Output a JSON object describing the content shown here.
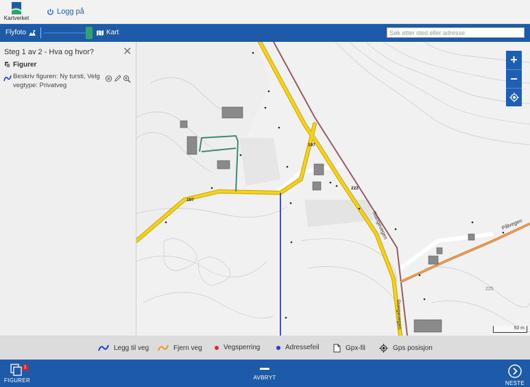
{
  "header": {
    "logo_text": "Kartverket",
    "login_label": "Logg på"
  },
  "toolbar": {
    "aerial_label": "Flyfoto",
    "map_label": "Kart",
    "search_placeholder": "Søk etter sted eller adresse"
  },
  "panel": {
    "title": "Steg 1 av 2 - Hva og hvor?",
    "section": "Figurer",
    "figure_text": "Beskriv figuren: Ny tursti, Velg vegtype: Privatveg"
  },
  "map": {
    "labels": {
      "road_197_a": "197",
      "road_197_b": "197",
      "road_222": "222",
      "stangevegen_1": "Stangevegen",
      "stangevegen_2": "Stangevegen",
      "palvegen": "Pålvegen",
      "contour_225": "225"
    },
    "scale_label": "50 m",
    "zoom_in": "+",
    "zoom_out": "−"
  },
  "legend": [
    {
      "label": "Legg til veg",
      "icon": "road-curve-blue"
    },
    {
      "label": "Fjern veg",
      "icon": "road-curve-orange"
    },
    {
      "label": "Vegsperring",
      "icon": "red-dot"
    },
    {
      "label": "Adressefeil",
      "icon": "blue-dot"
    },
    {
      "label": "Gpx-fil",
      "icon": "file-icon"
    },
    {
      "label": "Gps posisjon",
      "icon": "gps-icon"
    }
  ],
  "bottom": {
    "figures_label": "Figurer",
    "figures_badge": "1",
    "cancel_label": "Avbryt",
    "next_label": "Neste"
  },
  "colors": {
    "brand_blue": "#1d5aa7",
    "road_yellow": "#f5d31b",
    "road_outline": "#c9a300",
    "rail": "#9a5a5a",
    "path_green": "#3e8a6f",
    "new_road_blue": "#3b4fe0",
    "palvegen_orange": "#e08a3a"
  }
}
